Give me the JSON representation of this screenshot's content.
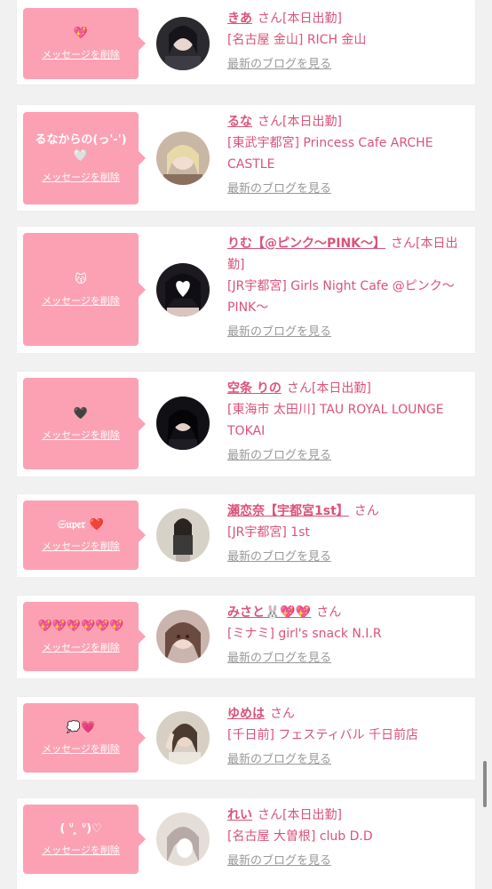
{
  "delete_label": "メッセージを削除",
  "blog_label": "最新のブログを見る",
  "colors": {
    "accent": "#d9537a",
    "bubble": "#fca1b3",
    "muted": "#999999"
  },
  "items": [
    {
      "message": "💖",
      "name": "きあ",
      "suffix": "さん[本日出勤]",
      "shop": "[名古屋 金山] RICH 金山"
    },
    {
      "message": "るなからの(っ'-')\n🤍",
      "name": "るな",
      "suffix": "さん[本日出勤]",
      "shop": "[東武宇都宮] Princess Cafe ARCHE CASTLE"
    },
    {
      "message": "😽",
      "name": "りむ【@ピンク〜PINK〜】",
      "suffix": "さん[本日出勤]",
      "shop": "[JR宇都宮] Girls Night Cafe @ピンク〜PINK〜"
    },
    {
      "message": "🖤",
      "name": "空条 りの",
      "suffix": "さん[本日出勤]",
      "shop": "[東海市 太田川] TAU ROYAL LOUNGE TOKAI"
    },
    {
      "message": "𝔖𝔲𝔭𝔢𝔯 ❤️",
      "name": "瀬恋奈【宇都宮1st】",
      "suffix": "さん",
      "shop": "[JR宇都宮] 1st"
    },
    {
      "message": "💖💖💖💖💖💖",
      "name": "みさと🐰💖💖",
      "suffix": "さん",
      "shop": "[ミナミ] girl's snack N.I.R"
    },
    {
      "message": "💭💗",
      "name": "ゆめは",
      "suffix": "さん",
      "shop": "[千日前] フェスティバル 千日前店"
    },
    {
      "message": "( ᐡ ̥ ᐡ)♡",
      "name": "れい",
      "suffix": "さん[本日出勤]",
      "shop": "[名古屋 大曽根] club D.D"
    }
  ]
}
